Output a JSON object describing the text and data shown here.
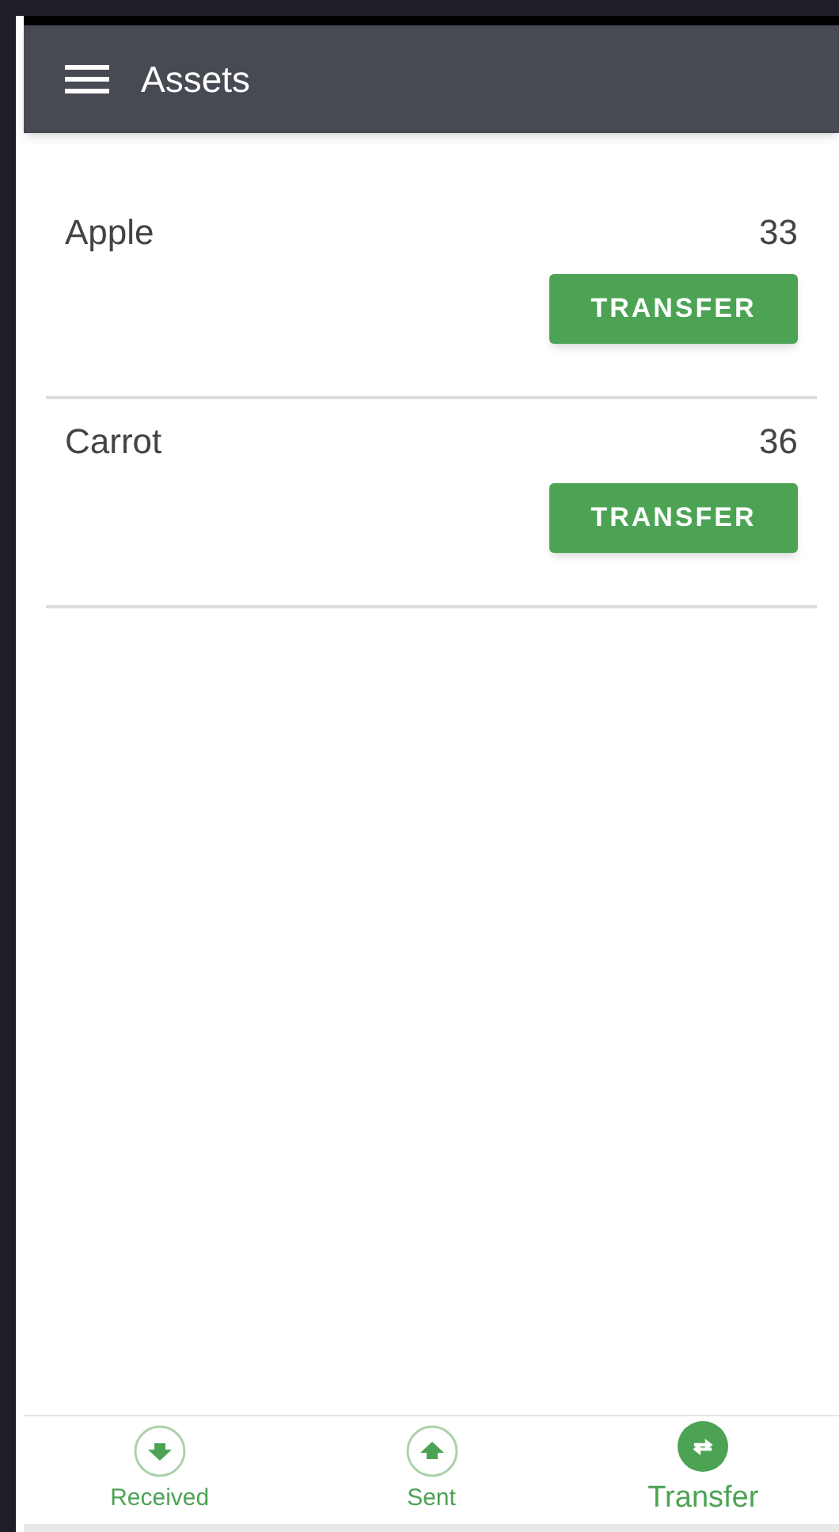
{
  "app_bar": {
    "title": "Assets"
  },
  "assets": [
    {
      "name": "Apple",
      "amount": "33",
      "button": "TRANSFER"
    },
    {
      "name": "Carrot",
      "amount": "36",
      "button": "TRANSFER"
    }
  ],
  "bottom_nav": [
    {
      "kind": "down",
      "label": "Received",
      "selected": false
    },
    {
      "kind": "up",
      "label": "Sent",
      "selected": false
    },
    {
      "kind": "swap",
      "label": "Transfer",
      "selected": true
    }
  ]
}
